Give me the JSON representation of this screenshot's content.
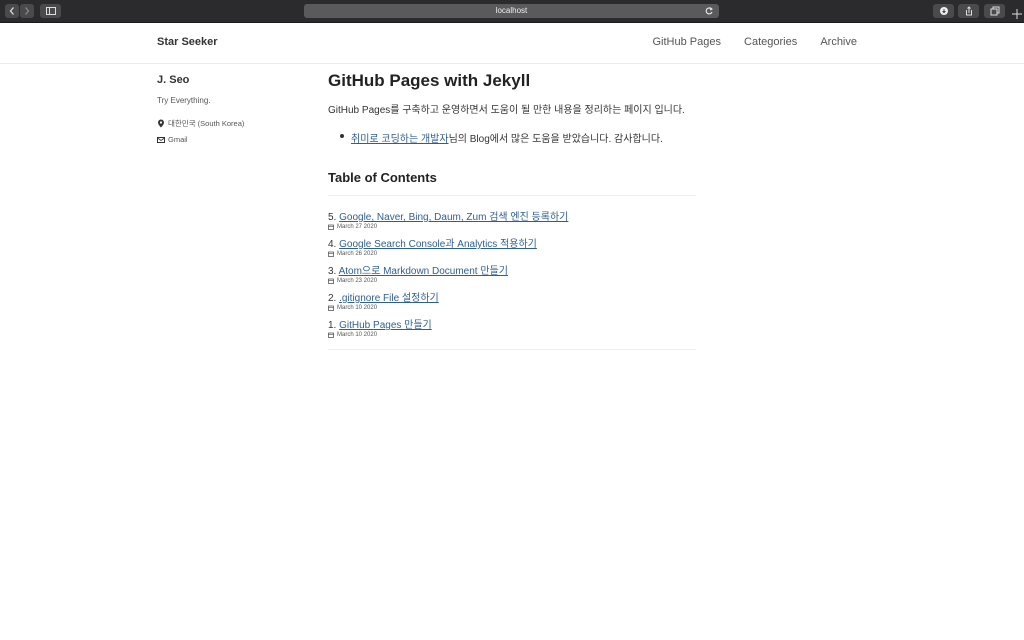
{
  "browser": {
    "url": "localhost"
  },
  "header": {
    "site_title": "Star Seeker",
    "nav": [
      "GitHub Pages",
      "Categories",
      "Archive"
    ]
  },
  "sidebar": {
    "name": "J. Seo",
    "bio": "Try Everything.",
    "location": "대한민국 (South Korea)",
    "email": "Gmail"
  },
  "main": {
    "title": "GitHub Pages with Jekyll",
    "intro": "GitHub Pages를 구축하고 운영하면서 도움이 될 만한 내용을 정리하는 페이지 입니다.",
    "credit_link": "취미로 코딩하는 개발자",
    "credit_rest": "님의 Blog에서 많은 도움을 받았습니다. 감사합니다.",
    "toc_title": "Table of Contents",
    "posts": [
      {
        "num": "5.",
        "title": "Google, Naver, Bing, Daum, Zum 검색 엔진 등록하기",
        "date": "March 27 2020"
      },
      {
        "num": "4.",
        "title": "Google Search Console과 Analytics 적용하기",
        "date": "March 26 2020"
      },
      {
        "num": "3.",
        "title": "Atom으로 Markdown Document 만들기",
        "date": "March 23 2020"
      },
      {
        "num": "2.",
        "title": ".gitignore File 설정하기",
        "date": "March 10 2020"
      },
      {
        "num": "1.",
        "title": "GitHub Pages 만들기",
        "date": "March 10 2020"
      }
    ]
  }
}
